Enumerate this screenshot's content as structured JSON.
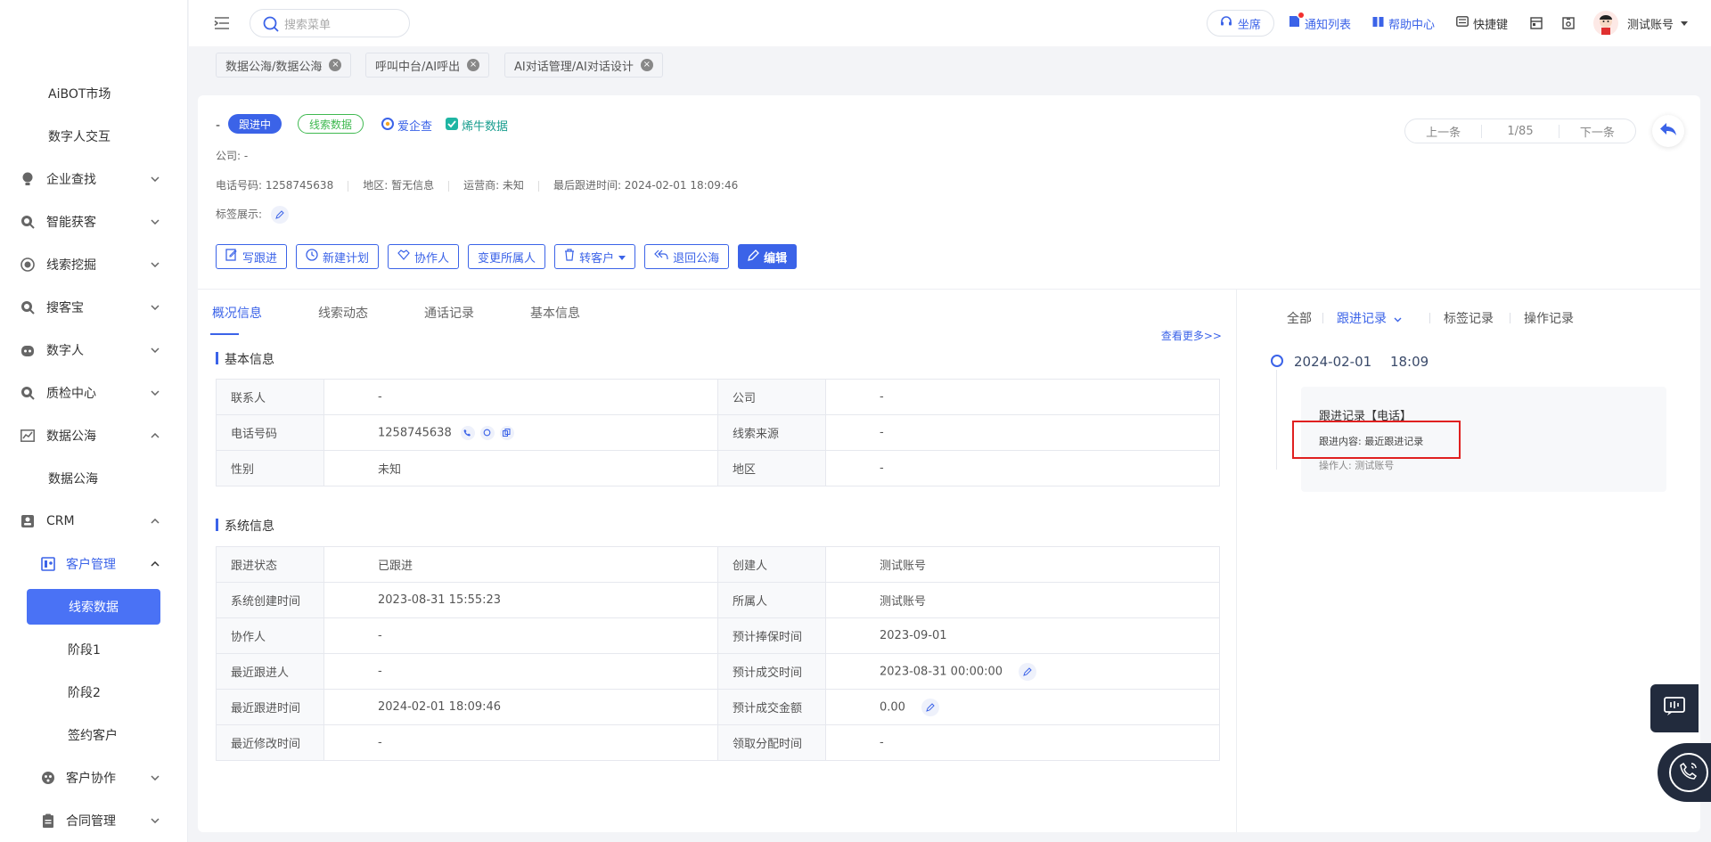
{
  "sidebar": {
    "items": [
      {
        "label": "AiBOT市场"
      },
      {
        "label": "数字人交互"
      },
      {
        "label": "企业查找"
      },
      {
        "label": "智能获客"
      },
      {
        "label": "线索挖掘"
      },
      {
        "label": "搜客宝"
      },
      {
        "label": "数字人"
      },
      {
        "label": "质检中心"
      },
      {
        "label": "数据公海"
      },
      {
        "label": "数据公海"
      },
      {
        "label": "CRM"
      },
      {
        "label": "客户管理"
      },
      {
        "label": "线索数据"
      },
      {
        "label": "阶段1"
      },
      {
        "label": "阶段2"
      },
      {
        "label": "签约客户"
      },
      {
        "label": "客户协作"
      },
      {
        "label": "合同管理"
      }
    ]
  },
  "topbar": {
    "search_placeholder": "搜索菜单",
    "seat": "坐席",
    "notify": "通知列表",
    "help": "帮助中心",
    "shortcut": "快捷键",
    "user": "测试账号"
  },
  "tabs": [
    {
      "label": "数据公海/数据公海"
    },
    {
      "label": "呼叫中台/AI呼出"
    },
    {
      "label": "AI对话管理/AI对话设计"
    }
  ],
  "header": {
    "name": "-",
    "status": "跟进中",
    "type": "线索数据",
    "link1": "爱企查",
    "link2": "烯牛数据",
    "company": "公司: -",
    "phone": "电话号码: 1258745638",
    "region": "地区: 暂无信息",
    "carrier": "运营商: 未知",
    "last_follow": "最后跟进时间: 2024-02-01 18:09:46",
    "tags_label": "标签展示:",
    "pager": {
      "prev": "上一条",
      "pos": "1/85",
      "next": "下一条"
    }
  },
  "actions": {
    "write": "写跟进",
    "plan": "新建计划",
    "collab": "协作人",
    "change_owner": "变更所属人",
    "to_customer": "转客户",
    "return_pool": "退回公海",
    "edit": "编辑"
  },
  "detail_tabs": [
    "概况信息",
    "线索动态",
    "通话记录",
    "基本信息"
  ],
  "basic": {
    "title": "基本信息",
    "more": "查看更多>>",
    "rows": [
      {
        "k1": "联系人",
        "v1": "-",
        "k2": "公司",
        "v2": "-"
      },
      {
        "k1": "电话号码",
        "v1": "1258745638",
        "k2": "线索来源",
        "v2": "-"
      },
      {
        "k1": "性别",
        "v1": "未知",
        "k2": "地区",
        "v2": "-"
      }
    ]
  },
  "system": {
    "title": "系统信息",
    "rows": [
      {
        "k1": "跟进状态",
        "v1": "已跟进",
        "k2": "创建人",
        "v2": "测试账号"
      },
      {
        "k1": "系统创建时间",
        "v1": "2023-08-31 15:55:23",
        "k2": "所属人",
        "v2": "测试账号"
      },
      {
        "k1": "协作人",
        "v1": "-",
        "k2": "预计捧保时间",
        "v2": "2023-09-01"
      },
      {
        "k1": "最近跟进人",
        "v1": "-",
        "k2": "预计成交时间",
        "v2": "2023-08-31 00:00:00"
      },
      {
        "k1": "最近跟进时间",
        "v1": "2024-02-01 18:09:46",
        "k2": "预计成交金额",
        "v2": "0.00"
      },
      {
        "k1": "最近修改时间",
        "v1": "-",
        "k2": "领取分配时间",
        "v2": "-"
      }
    ]
  },
  "records": {
    "tabs": [
      "全部",
      "跟进记录",
      "标签记录",
      "操作记录"
    ],
    "date": "2024-02-01",
    "time": "18:09",
    "title": "跟进记录【电话】",
    "content": "跟进内容: 最近跟进记录",
    "operator": "操作人: 测试账号"
  },
  "colors": {
    "accent": "#3b63e8",
    "active_nav": "#4a72f5",
    "highlight": "#e02020",
    "success": "#3fb950"
  }
}
